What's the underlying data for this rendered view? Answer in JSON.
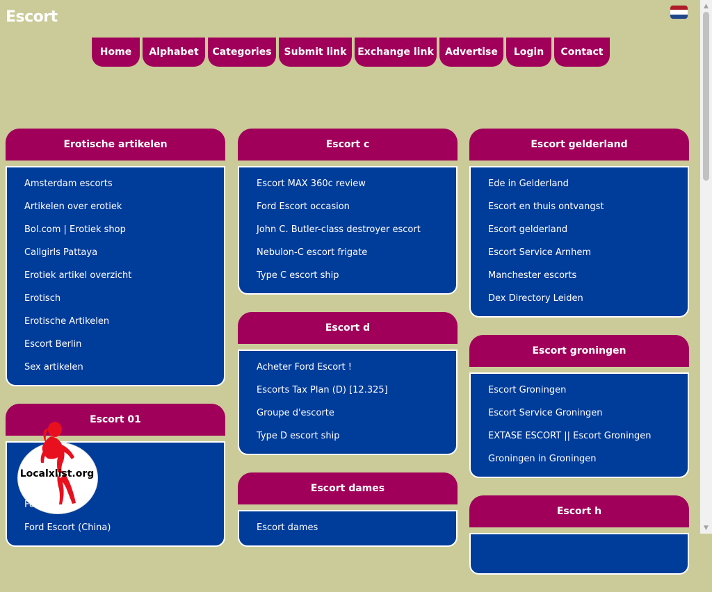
{
  "site": {
    "title": "Escort",
    "flag_icon": "netherlands-flag-icon"
  },
  "nav": [
    {
      "label": "Home"
    },
    {
      "label": "Alphabet"
    },
    {
      "label": "Categories"
    },
    {
      "label": "Submit link"
    },
    {
      "label": "Exchange link"
    },
    {
      "label": "Advertise"
    },
    {
      "label": "Login"
    },
    {
      "label": "Contact"
    }
  ],
  "columns": [
    [
      {
        "title": "Erotische artikelen",
        "links": [
          "Amsterdam escorts",
          "Artikelen over erotiek",
          "Bol.com | Erotiek shop",
          "Callgirls Pattaya",
          "Erotiek artikel overzicht",
          "Erotisch",
          "Erotische Artikelen",
          "Escort Berlin",
          "Sex artikelen"
        ]
      },
      {
        "title": "Escort 01",
        "links": [
          "Fo",
          "Ford Escort (China)"
        ]
      }
    ],
    [
      {
        "title": "Escort c",
        "links": [
          "Escort MAX 360c review",
          "Ford Escort occasion",
          "John C. Butler-class destroyer escort",
          "Nebulon-C escort frigate",
          "Type C escort ship"
        ]
      },
      {
        "title": "Escort d",
        "links": [
          "Acheter Ford Escort !",
          "Escorts Tax Plan (D) [12.325]",
          "Groupe d'escorte",
          "Type D escort ship"
        ]
      },
      {
        "title": "Escort dames",
        "links": [
          "Escort dames"
        ]
      }
    ],
    [
      {
        "title": "Escort gelderland",
        "links": [
          "Ede in Gelderland",
          "Escort en thuis ontvangst",
          "Escort gelderland",
          "Escort Service Arnhem",
          "Manchester escorts",
          "Dex Directory Leiden"
        ]
      },
      {
        "title": "Escort groningen",
        "links": [
          "Escort Groningen",
          "Escort Service Groningen",
          "EXTASE ESCORT || Escort Groningen",
          "Groningen in Groningen"
        ]
      },
      {
        "title": "Escort h",
        "links": []
      }
    ]
  ],
  "watermark": {
    "text": "Localxlist.org"
  },
  "colors": {
    "background": "#cbcb99",
    "header": "#a0005a",
    "panel": "#003c9a",
    "text": "#ffffff"
  }
}
